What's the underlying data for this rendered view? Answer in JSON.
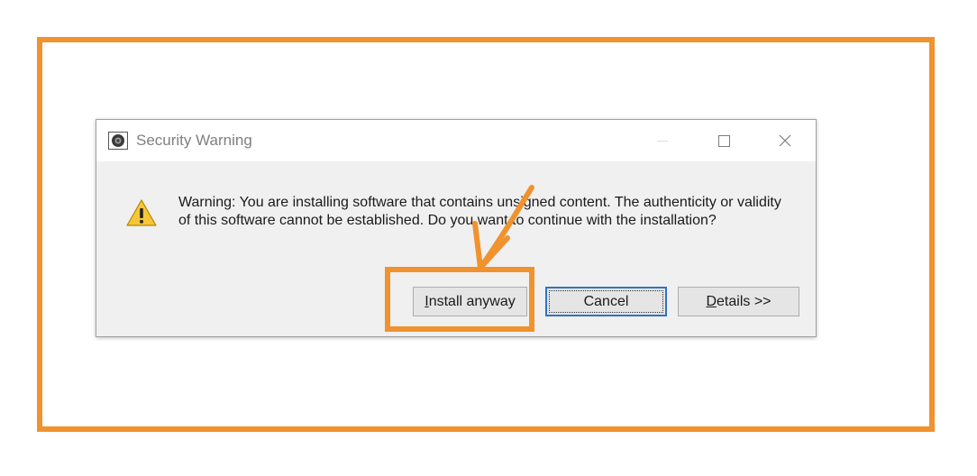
{
  "dialog": {
    "title": "Security Warning",
    "app_icon": "eclipse-gear-icon",
    "message": "Warning: You are installing software that contains unsigned content. The authenticity or validity of this software cannot be established. Do you want to continue with the installation?",
    "warning_icon": "warning-triangle-icon",
    "buttons": {
      "install_prefix": "",
      "install_mnemonic": "I",
      "install_rest": "nstall anyway",
      "cancel": "Cancel",
      "details_mnemonic": "D",
      "details_rest": "etails >>"
    },
    "titlebar_icons": [
      "minimize-icon",
      "maximize-icon",
      "close-icon"
    ]
  },
  "annotation": {
    "color": "#f0922e",
    "highlight": "install-anyway-button",
    "arrow_icon": "hand-drawn-arrow-icon"
  }
}
